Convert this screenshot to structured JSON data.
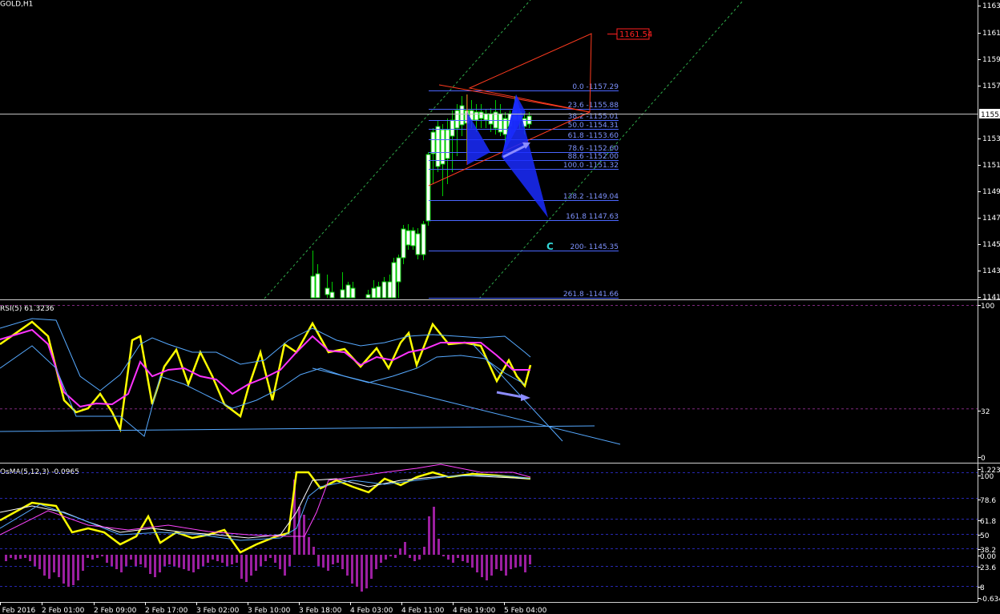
{
  "window": {
    "symbol_title": "GOLD,H1"
  },
  "colors": {
    "background": "#000000",
    "grid": "#1e1e6e",
    "bull": "#00cc00",
    "candle_body_up": "#ffffff",
    "channel": "#2faa4a",
    "fib": "#4a66ff",
    "fib_text": "#7f93ff",
    "triangle": "#ff3b1f",
    "abc_fill": "#1a2bff",
    "rsi_yellow": "#ffff00",
    "rsi_magenta": "#ff33ff",
    "band": "#56a9ff",
    "osma_bar": "#9b1fa0",
    "label_box": "#ff2020"
  },
  "price_axis": {
    "labels": [
      "1163.",
      "1161.",
      "1159.",
      "1157.",
      "1155.",
      "1153.",
      "1151.",
      "1149.",
      "1147.",
      "1145.",
      "1143.",
      "1141."
    ],
    "current_price": "1155.",
    "target_label": "1161.54"
  },
  "fib_levels": [
    {
      "label": "0.0 -1157.29"
    },
    {
      "label": "23.6 -1155.88"
    },
    {
      "label": "38.2 -1155.01"
    },
    {
      "label": "50.0 -1154.31"
    },
    {
      "label": "61.8 -1153.60"
    },
    {
      "label": "78.6 -1152.60"
    },
    {
      "label": "88.6 -1152.00"
    },
    {
      "label": "100.0 -1151.32"
    },
    {
      "label": "138.2 -1149.04"
    },
    {
      "label": "161.8 1147.63"
    },
    {
      "label": "200- 1145.35"
    },
    {
      "label": "261.8 -1141.66"
    }
  ],
  "wave_label": "C",
  "rsi_panel": {
    "title": "RSI(5) 61.3236",
    "axis": [
      "100",
      "32",
      "0"
    ]
  },
  "osma_panel": {
    "title": "OsMA(5,12,3) -0.0965",
    "axis": [
      "1.2232",
      "100",
      "78.6",
      "61.8",
      "50",
      "38.2",
      "0.00",
      "23.6",
      "8",
      "-0.634"
    ]
  },
  "time_axis": [
    "2 Feb 2016",
    "2 Feb 01:00",
    "2 Feb 09:00",
    "2 Feb 17:00",
    "3 Feb 02:00",
    "3 Feb 10:00",
    "3 Feb 18:00",
    "4 Feb 03:00",
    "4 Feb 11:00",
    "4 Feb 19:00",
    "5 Feb 04:00"
  ]
}
